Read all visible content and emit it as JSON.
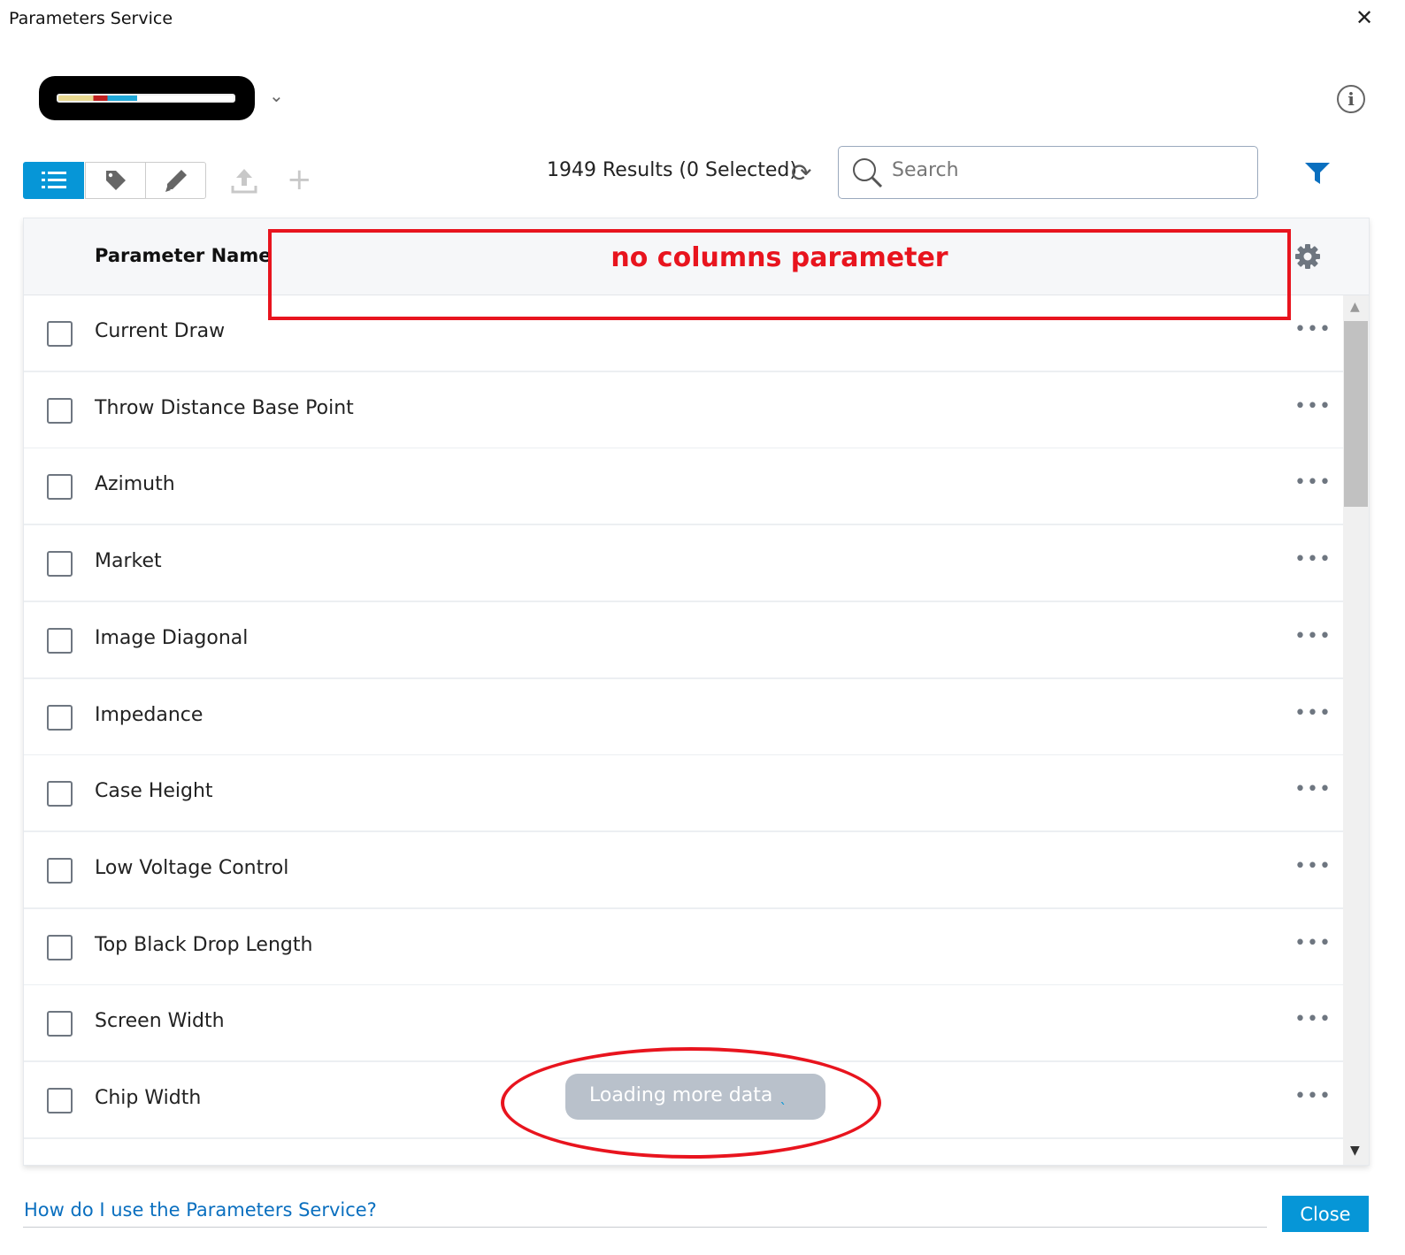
{
  "window": {
    "title": "Parameters Service",
    "close_glyph": "✕"
  },
  "header": {
    "chevron": "⌄",
    "info": "i"
  },
  "toolbar": {
    "results": "1949 Results (0 Selected)",
    "refresh": "⟳",
    "plus": "+",
    "search_placeholder": "Search",
    "search_value": ""
  },
  "table": {
    "column_header": "Parameter Name",
    "row_action": "•••",
    "rows": [
      "Current Draw",
      "Throw Distance Base Point",
      "Azimuth",
      "Market",
      "Image Diagonal",
      "Impedance",
      "Case Height",
      "Low Voltage Control",
      "Top Black Drop Length",
      "Screen Width",
      "Chip Width"
    ]
  },
  "annotations": {
    "header_note": "no columns parameter"
  },
  "loading": {
    "text": "Loading more data",
    "spinner": "ˎ"
  },
  "footer": {
    "help_link": "How do I use the Parameters Service?",
    "close_label": "Close"
  },
  "scrollbar": {
    "up": "▲",
    "down": "▼"
  },
  "colors": {
    "accent": "#0696d7",
    "annotation": "#e8141e",
    "link": "#0a6fbf"
  }
}
